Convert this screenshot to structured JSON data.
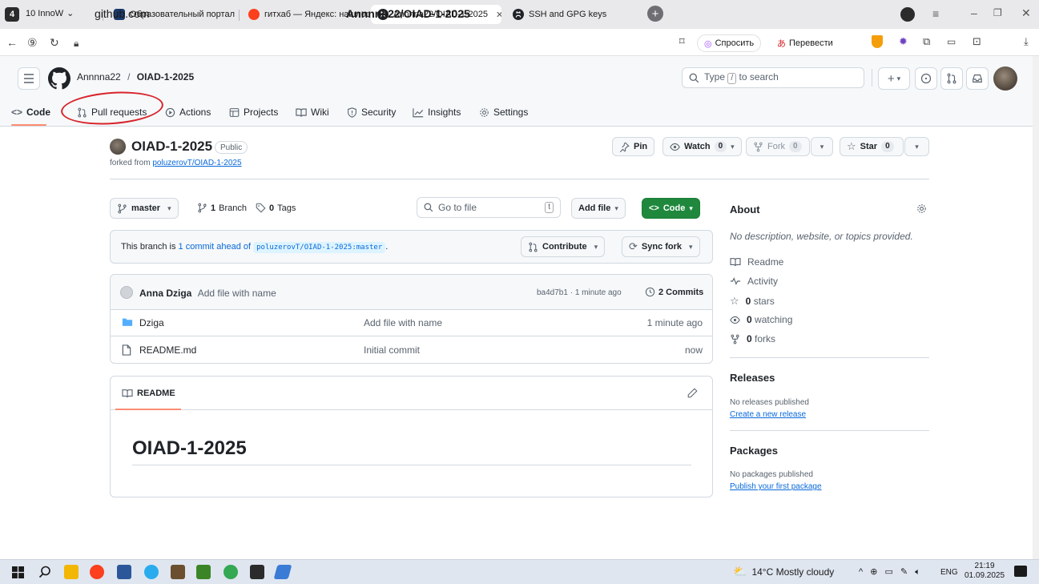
{
  "browser": {
    "tab_counter": "4",
    "workspace": "10 InnoW",
    "tabs": [
      {
        "label": "Образовательный портал"
      },
      {
        "label": "гитхаб — Яндекс: нашлос"
      },
      {
        "label": "Annnna22/OIAD-1-2025"
      },
      {
        "label": "SSH and GPG keys"
      }
    ],
    "url": "github.com",
    "page_title": "Annnna22/OIAD-1-2025",
    "ask_label": "Спросить",
    "translate_label": "Перевести"
  },
  "header": {
    "owner": "Annnna22",
    "repo": "OIAD-1-2025",
    "search_prefix": "Type",
    "search_key": "/",
    "search_suffix": "to search"
  },
  "repo_nav": [
    {
      "label": "Code"
    },
    {
      "label": "Pull requests"
    },
    {
      "label": "Actions"
    },
    {
      "label": "Projects"
    },
    {
      "label": "Wiki"
    },
    {
      "label": "Security"
    },
    {
      "label": "Insights"
    },
    {
      "label": "Settings"
    }
  ],
  "repo": {
    "name": "OIAD-1-2025",
    "visibility": "Public",
    "forked_prefix": "forked from",
    "forked_link": "poluzerovT/OIAD-1-2025",
    "pin_label": "Pin",
    "watch_label": "Watch",
    "watch_count": "0",
    "fork_label": "Fork",
    "fork_count": "0",
    "star_label": "Star",
    "star_count": "0"
  },
  "toolbar": {
    "branch": "master",
    "branch_count": "1",
    "branch_label": "Branch",
    "tag_count": "0",
    "tag_label": "Tags",
    "goto_placeholder": "Go to file",
    "goto_key": "t",
    "add_file": "Add file",
    "code": "Code"
  },
  "ahead": {
    "prefix": "This branch is",
    "link": "1 commit ahead of",
    "ref": "poluzerovT/OIAD-1-2025:master",
    "suffix": ".",
    "contribute": "Contribute",
    "sync": "Sync fork"
  },
  "commit": {
    "author": "Anna Dziga",
    "message": "Add file with name",
    "meta": "ba4d7b1 · 1 minute ago",
    "commits_label": "2 Commits"
  },
  "files": [
    {
      "name": "Dziga",
      "message": "Add file with name",
      "date": "1 minute ago",
      "type": "folder"
    },
    {
      "name": "README.md",
      "message": "Initial commit",
      "date": "now",
      "type": "file"
    }
  ],
  "readme": {
    "tab": "README",
    "heading": "OIAD-1-2025"
  },
  "sidebar": {
    "about": "About",
    "description": "No description, website, or topics provided.",
    "readme": "Readme",
    "activity": "Activity",
    "stars_count": "0",
    "stars_label": "stars",
    "watching_count": "0",
    "watching_label": "watching",
    "forks_count": "0",
    "forks_label": "forks",
    "releases": "Releases",
    "releases_none": "No releases published",
    "releases_link": "Create a new release",
    "packages": "Packages",
    "packages_none": "No packages published",
    "packages_link": "Publish your first package"
  },
  "taskbar": {
    "weather": "14°C  Mostly cloudy",
    "lang": "ENG",
    "time": "21:19",
    "date": "01.09.2025"
  },
  "colors": {
    "accent_green": "#1f883d",
    "link_blue": "#0969da",
    "annotation_red": "#d8232a",
    "tab_underline": "#fd8c73"
  }
}
